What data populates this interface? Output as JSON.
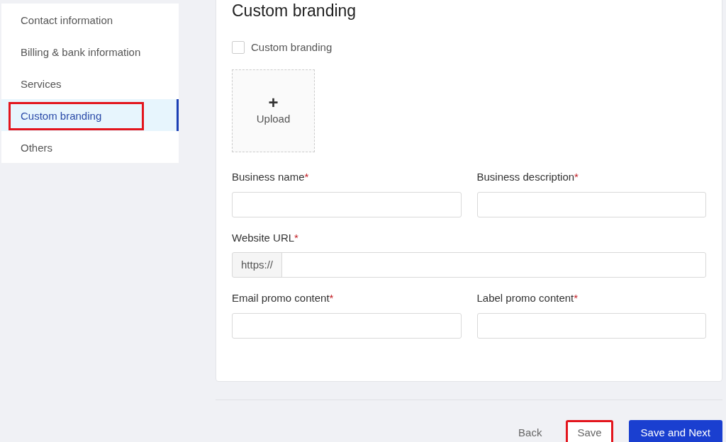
{
  "sidebar": {
    "items": [
      {
        "label": "Contact information",
        "selected": false,
        "highlighted": false
      },
      {
        "label": "Billing & bank information",
        "selected": false,
        "highlighted": false
      },
      {
        "label": "Services",
        "selected": false,
        "highlighted": false
      },
      {
        "label": "Custom branding",
        "selected": true,
        "highlighted": true
      },
      {
        "label": "Others",
        "selected": false,
        "highlighted": false
      }
    ]
  },
  "form": {
    "title": "Custom branding",
    "checkbox": {
      "label": "Custom branding",
      "checked": false
    },
    "upload": {
      "icon": "+",
      "label": "Upload"
    },
    "rows": [
      [
        {
          "label": "Business name",
          "required_mark": "*"
        },
        {
          "label": "Business description",
          "required_mark": "*"
        }
      ],
      [
        {
          "label": "Website URL",
          "required_mark": "*",
          "prefix": "https://"
        }
      ],
      [
        {
          "label": "Email promo content",
          "required_mark": "*"
        },
        {
          "label": "Label promo content",
          "required_mark": "*"
        }
      ]
    ]
  },
  "footer": {
    "buttons": [
      {
        "label": "Back",
        "kind": "link",
        "highlighted": false
      },
      {
        "label": "Save",
        "kind": "plain",
        "highlighted": true
      },
      {
        "label": "Save and Next",
        "kind": "primary",
        "highlighted": false
      }
    ]
  }
}
